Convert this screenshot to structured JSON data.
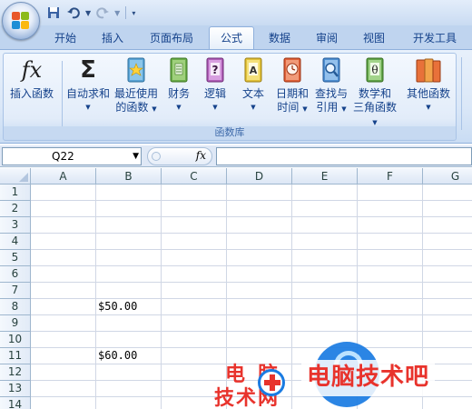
{
  "quick_access": {
    "save_icon": "save-icon",
    "undo_icon": "undo-icon",
    "redo_icon": "redo-icon"
  },
  "tabs": [
    {
      "label": "开始",
      "active": false
    },
    {
      "label": "插入",
      "active": false
    },
    {
      "label": "页面布局",
      "active": false
    },
    {
      "label": "公式",
      "active": true
    },
    {
      "label": "数据",
      "active": false
    },
    {
      "label": "审阅",
      "active": false
    },
    {
      "label": "视图",
      "active": false
    },
    {
      "label": "开发工具",
      "active": false
    }
  ],
  "ribbon": {
    "group_label": "函数库",
    "insert_function": {
      "icon_text": "fx",
      "label": "插入函数"
    },
    "autosum": {
      "icon_text": "Σ",
      "label": "自动求和"
    },
    "recent": {
      "line1": "最近使用",
      "line2": "的函数"
    },
    "financial": {
      "label": "财务"
    },
    "logical": {
      "label": "逻辑"
    },
    "text": {
      "label": "文本"
    },
    "datetime": {
      "line1": "日期和",
      "line2": "时间"
    },
    "lookup": {
      "line1": "查找与",
      "line2": "引用"
    },
    "math": {
      "line1": "数学和",
      "line2": "三角函数"
    },
    "more": {
      "label": "其他函数"
    }
  },
  "formula_bar": {
    "name_box": "Q22",
    "fx_label": "fx",
    "formula": ""
  },
  "sheet": {
    "columns": [
      "A",
      "B",
      "C",
      "D",
      "E",
      "F",
      "G"
    ],
    "rows": [
      "1",
      "2",
      "3",
      "4",
      "5",
      "6",
      "7",
      "8",
      "9",
      "10",
      "11",
      "12",
      "13",
      "14"
    ],
    "cells": {
      "B8": "$50.00",
      "B11": "$60.00"
    }
  },
  "watermark": {
    "logo_line1": "电脑",
    "logo_line2": "技术网",
    "banner_text": "电脑技术吧",
    "colors": {
      "red": "#e8332c",
      "blue": "#1a7be2"
    }
  },
  "colors": {
    "ribbon_bg": "#dbe8f8",
    "tab_text": "#15428b",
    "grid_line": "#d0d7e5",
    "header_bg": "#dce7f5"
  }
}
